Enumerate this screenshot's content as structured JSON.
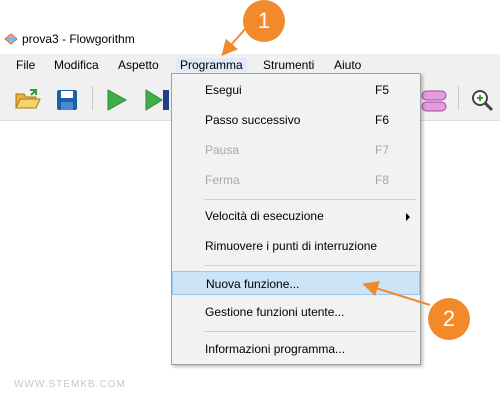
{
  "window": {
    "title": "prova3 - Flowgorithm",
    "icon": "flowgorithm-app-icon"
  },
  "menubar": {
    "items": [
      {
        "label": "File"
      },
      {
        "label": "Modifica"
      },
      {
        "label": "Aspetto"
      },
      {
        "label": "Programma"
      },
      {
        "label": "Strumenti"
      },
      {
        "label": "Aiuto"
      }
    ]
  },
  "toolbar": {
    "icons": [
      "open-folder-icon",
      "save-icon",
      "run-icon",
      "step-icon",
      "add-function-icon",
      "zoom-in-icon"
    ]
  },
  "dropdown": {
    "items": [
      {
        "label": "Esegui",
        "shortcut": "F5",
        "enabled": true
      },
      {
        "label": "Passo successivo",
        "shortcut": "F6",
        "enabled": true
      },
      {
        "label": "Pausa",
        "shortcut": "F7",
        "enabled": false
      },
      {
        "label": "Ferma",
        "shortcut": "F8",
        "enabled": false
      },
      {
        "label": "Velocità di esecuzione",
        "shortcut": "",
        "enabled": true,
        "submenu": true
      },
      {
        "label": "Rimuovere i punti di interruzione",
        "shortcut": "",
        "enabled": true
      },
      {
        "label": "Nuova funzione...",
        "shortcut": "",
        "enabled": true,
        "highlighted": true
      },
      {
        "label": "Gestione funzioni utente...",
        "shortcut": "",
        "enabled": true
      },
      {
        "label": "Informazioni programma...",
        "shortcut": "",
        "enabled": true
      }
    ]
  },
  "annotations": {
    "badge1": "1",
    "badge2": "2",
    "color": "#f28a2c"
  },
  "watermark": "WWW.STEMKB.COM"
}
